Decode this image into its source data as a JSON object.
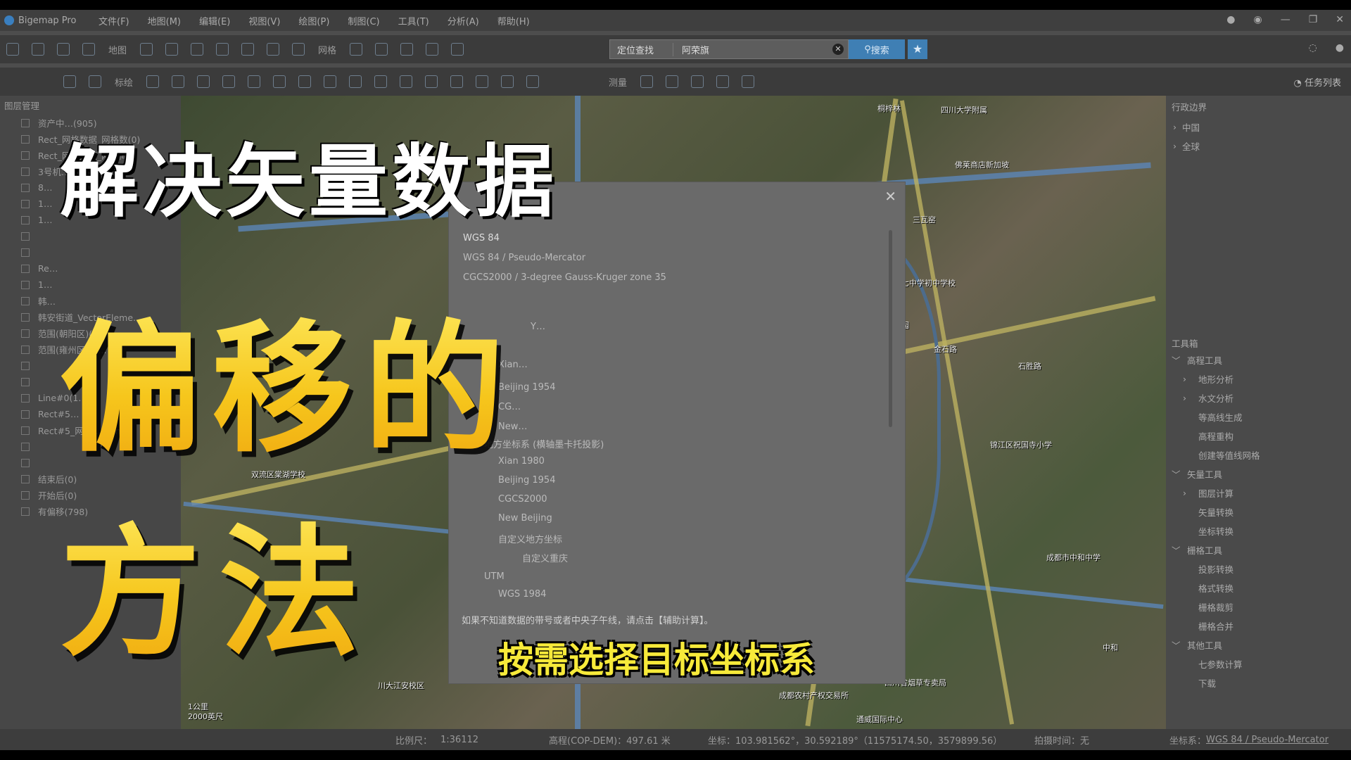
{
  "app": {
    "title": "Bigemap Pro"
  },
  "menu": [
    "文件(F)",
    "地图(M)",
    "编辑(E)",
    "视图(V)",
    "绘图(P)",
    "制图(C)",
    "工具(T)",
    "分析(A)",
    "帮助(H)"
  ],
  "toolbar1": {
    "map_label": "地图",
    "grid_label": "网格"
  },
  "search": {
    "mode": "定位查找",
    "value": "阿荣旗",
    "button": "搜索"
  },
  "toolbar2": {
    "mark_label": "标绘",
    "measure_label": "测量",
    "tasks_label": "任务列表"
  },
  "left_panel": {
    "title": "图层管理",
    "layers": [
      "资产中…(905)",
      "Rect_网格数据_网格数(0)",
      "Rect_网格数据_网格间...",
      "3号机…",
      "8…",
      "1…",
      "1…",
      "",
      "",
      "Re…",
      "1…",
      "韩…",
      "韩安街道_VectorEleme...",
      "范围(朝阳区)(43)",
      "范围(雍州区)(2…",
      "",
      "",
      "Line#0(1…",
      "Rect#5…",
      "Rect#5_网格…men…",
      "",
      "",
      "结束后(0)",
      "开始后(0)",
      "有偏移(798)"
    ]
  },
  "right_panel": {
    "admin_title": "行政边界",
    "admin_items": [
      "中国",
      "全球"
    ],
    "toolbox_title": "工具箱",
    "tools": [
      {
        "label": "高程工具",
        "level": 0,
        "arrow": "﹀"
      },
      {
        "label": "地形分析",
        "level": 1,
        "arrow": "›"
      },
      {
        "label": "水文分析",
        "level": 1,
        "arrow": "›"
      },
      {
        "label": "等高线生成",
        "level": 1,
        "arrow": ""
      },
      {
        "label": "高程重构",
        "level": 1,
        "arrow": ""
      },
      {
        "label": "创建等值线网格",
        "level": 1,
        "arrow": ""
      },
      {
        "label": "矢量工具",
        "level": 0,
        "arrow": "﹀"
      },
      {
        "label": "图层计算",
        "level": 1,
        "arrow": "›"
      },
      {
        "label": "矢量转换",
        "level": 1,
        "arrow": ""
      },
      {
        "label": "坐标转换",
        "level": 1,
        "arrow": ""
      },
      {
        "label": "栅格工具",
        "level": 0,
        "arrow": "﹀"
      },
      {
        "label": "投影转换",
        "level": 1,
        "arrow": ""
      },
      {
        "label": "格式转换",
        "level": 1,
        "arrow": ""
      },
      {
        "label": "栅格裁剪",
        "level": 1,
        "arrow": ""
      },
      {
        "label": "栅格合并",
        "level": 1,
        "arrow": ""
      },
      {
        "label": "其他工具",
        "level": 0,
        "arrow": "﹀"
      },
      {
        "label": "七参数计算",
        "level": 1,
        "arrow": ""
      },
      {
        "label": "下载",
        "level": 1,
        "arrow": ""
      }
    ]
  },
  "dialog": {
    "items": [
      "WGS 84",
      "WGS 84 / Pseudo-Mercator",
      "CGCS2000 / 3-degree Gauss-Kruger zone 35",
      "Y…",
      "Xian…",
      "Beijing 1954",
      "CG…",
      "New…",
      "地方坐标系 (横轴墨卡托投影)",
      "Xian 1980",
      "Beijing 1954",
      "CGCS2000",
      "New Beijing",
      "自定义地方坐标",
      "自定义重庆",
      "UTM",
      "WGS 1984"
    ],
    "footer": "如果不知道数据的带号或者中央子午线，请点击【辅助计算】。"
  },
  "map_labels": [
    "桐梓林",
    "四川大学附属",
    "成都市第七中学初中学校",
    "三瓦窑",
    "东永安公园",
    "金石路",
    "石胜路",
    "锦江区祝国寺小学",
    "成都市中和中学",
    "四川省烟草专卖局",
    "成都农村产权交易所",
    "通威国际中心",
    "川大江安校区",
    "双流区棠湖学校",
    "佛莱商店新加坡",
    "中和",
    "2000英尺",
    "1公里"
  ],
  "status": {
    "scale_label": "比例尺：",
    "scale_value": "1:36112",
    "elev": "高程(COP-DEM)：497.61 米",
    "coord": "坐标：103.981562°，30.592189°（11575174.50，3579899.56）",
    "shot_time": "拍摄时间：无",
    "crs_label": "坐标系：",
    "crs_value": "WGS 84 / Pseudo-Mercator"
  },
  "overlay": {
    "line1": "解决矢量数据",
    "line2": "偏移的",
    "line3": "方法",
    "subtitle": "按需选择目标坐标系"
  }
}
